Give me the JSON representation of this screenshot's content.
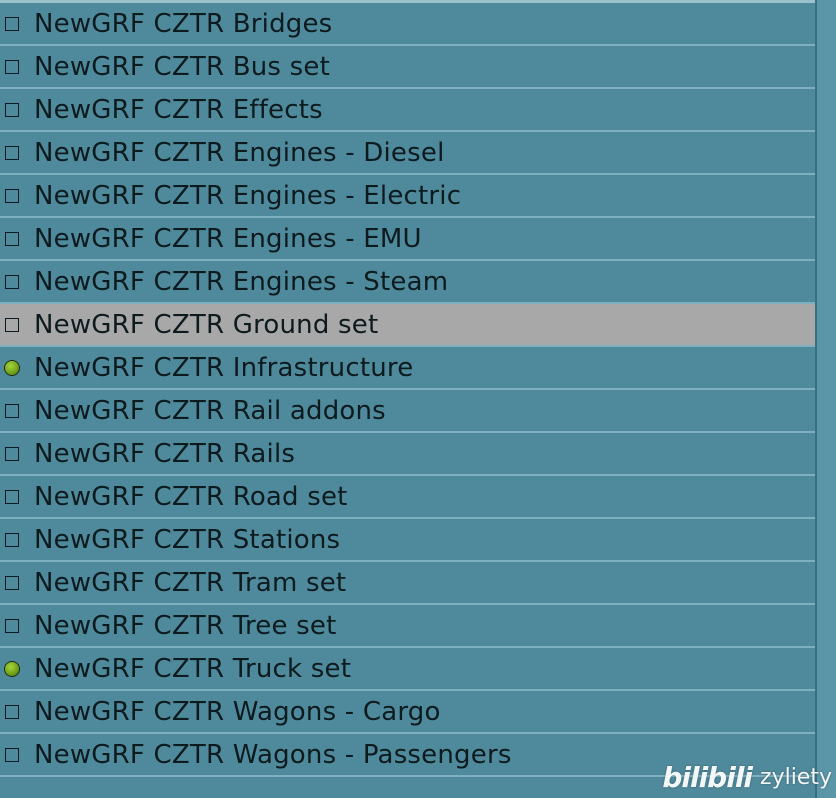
{
  "list": {
    "items": [
      {
        "label": "NewGRF CZTR Bridges",
        "status": "inactive",
        "selected": false
      },
      {
        "label": "NewGRF CZTR Bus set",
        "status": "inactive",
        "selected": false
      },
      {
        "label": "NewGRF CZTR Effects",
        "status": "inactive",
        "selected": false
      },
      {
        "label": "NewGRF CZTR Engines - Diesel",
        "status": "inactive",
        "selected": false
      },
      {
        "label": "NewGRF CZTR Engines - Electric",
        "status": "inactive",
        "selected": false
      },
      {
        "label": "NewGRF CZTR Engines - EMU",
        "status": "inactive",
        "selected": false
      },
      {
        "label": "NewGRF CZTR Engines - Steam",
        "status": "inactive",
        "selected": false
      },
      {
        "label": "NewGRF CZTR Ground set",
        "status": "inactive",
        "selected": true
      },
      {
        "label": "NewGRF CZTR Infrastructure",
        "status": "active",
        "selected": false
      },
      {
        "label": "NewGRF CZTR Rail addons",
        "status": "inactive",
        "selected": false
      },
      {
        "label": "NewGRF CZTR Rails",
        "status": "inactive",
        "selected": false
      },
      {
        "label": "NewGRF CZTR Road set",
        "status": "inactive",
        "selected": false
      },
      {
        "label": "NewGRF CZTR Stations",
        "status": "inactive",
        "selected": false
      },
      {
        "label": "NewGRF CZTR Tram set",
        "status": "inactive",
        "selected": false
      },
      {
        "label": "NewGRF CZTR Tree set",
        "status": "inactive",
        "selected": false
      },
      {
        "label": "NewGRF CZTR Truck set",
        "status": "active",
        "selected": false
      },
      {
        "label": "NewGRF CZTR Wagons - Cargo",
        "status": "inactive",
        "selected": false
      },
      {
        "label": "NewGRF CZTR Wagons - Passengers",
        "status": "inactive",
        "selected": false
      }
    ]
  },
  "watermark": {
    "logo": "bilibili",
    "user": "zyliety"
  },
  "colors": {
    "background": "#4f8a9c",
    "row_separator": "#7fb0bf",
    "selected_row": "#a8a8a8",
    "active_dot": "#7fb020",
    "text": "#0d1a1e"
  },
  "icons": {
    "inactive": "checkbox-empty-icon",
    "active": "green-dot-icon"
  }
}
